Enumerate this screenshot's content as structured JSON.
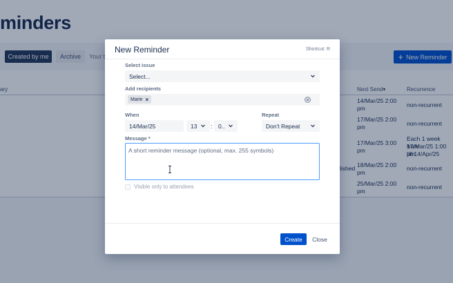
{
  "background": {
    "page_title": "minders",
    "tabs": [
      {
        "label": "Created by me",
        "active": true
      },
      {
        "label": "Archive",
        "active": false
      }
    ],
    "filter_text": "Your ti",
    "new_button_label": "New Reminder",
    "columns": {
      "col1": "ary",
      "next_send": "Next Send",
      "next_send_sort": "▾",
      "recurrence": "Recurrence"
    },
    "rows": [
      {
        "extra": "",
        "next_send": [
          "14/Mar/25 2:00",
          "pm"
        ],
        "recurrence": [
          "non-recurrent"
        ]
      },
      {
        "extra": "",
        "next_send": [
          "17/Mar/25 2:00",
          "pm"
        ],
        "recurrence": [
          "non-recurrent"
        ]
      },
      {
        "extra": "",
        "next_send": [
          "17/Mar/25 3:00",
          "pm"
        ],
        "recurrence": [
          "Each 1 week from",
          "17/Mar/25 1:00 pm",
          "till 14/Apr/25"
        ]
      },
      {
        "extra": "lished",
        "next_send": [
          "18/Mar/25 2:00",
          "pm"
        ],
        "recurrence": [
          "non-recurrent"
        ]
      },
      {
        "extra": "",
        "next_send": [
          "25/Mar/25 2:00",
          "pm"
        ],
        "recurrence": [
          "non-recurrent"
        ]
      }
    ]
  },
  "modal": {
    "title": "New Reminder",
    "shortcut": "Shortcut: R",
    "select_issue": {
      "label": "Select issue",
      "value": "Select..."
    },
    "recipients": {
      "label": "Add recipients",
      "chips": [
        "Marie"
      ]
    },
    "when": {
      "label": "When",
      "date": "14/Mar/25",
      "hour": "13",
      "minute": "0.."
    },
    "repeat": {
      "label": "Repeat",
      "value": "Don't Repeat"
    },
    "message": {
      "label": "Message",
      "required_mark": "*",
      "placeholder": "A short reminder message (optional, max. 255 symbols)"
    },
    "visible_only": {
      "label": "Visible only to attendees",
      "checked": false
    },
    "buttons": {
      "create": "Create",
      "close": "Close"
    }
  },
  "colors": {
    "primary": "#0052cc",
    "dark_tab": "#253858",
    "focus_border": "#4c9aff"
  }
}
